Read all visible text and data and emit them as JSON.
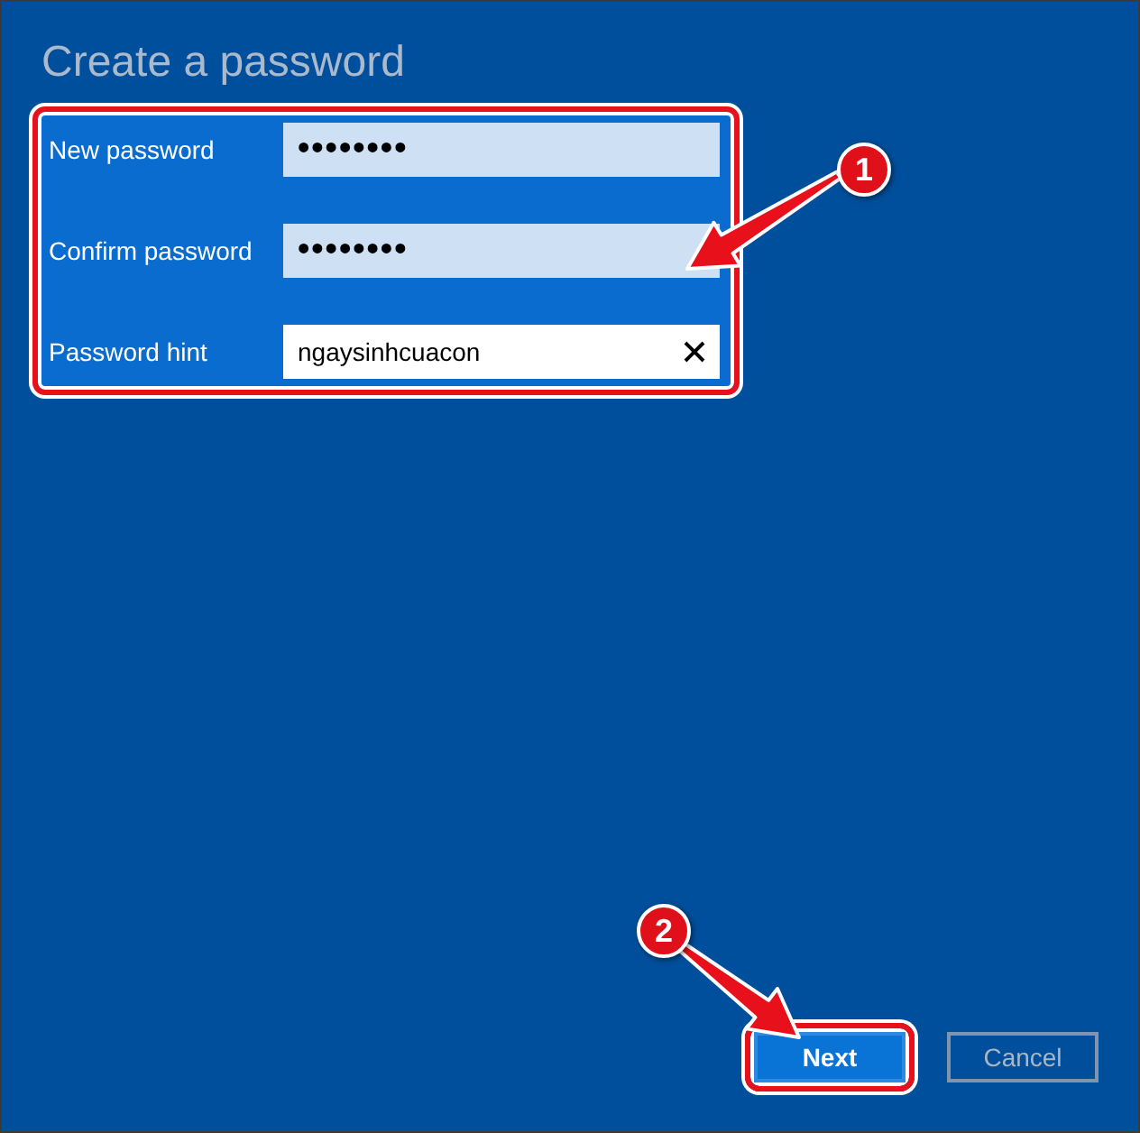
{
  "title": "Create a password",
  "fields": [
    {
      "label": "New password",
      "value": "••••••••",
      "kind": "password",
      "focused": false
    },
    {
      "label": "Confirm password",
      "value": "••••••••",
      "kind": "password",
      "focused": false
    },
    {
      "label": "Password hint",
      "value": "ngaysinhcuacon",
      "kind": "text",
      "focused": true
    }
  ],
  "buttons": [
    {
      "label": "Next",
      "kind": "primary",
      "highlighted": true
    },
    {
      "label": "Cancel",
      "kind": "secondary",
      "highlighted": false
    }
  ],
  "annotations": [
    {
      "number": "1"
    },
    {
      "number": "2"
    }
  ]
}
